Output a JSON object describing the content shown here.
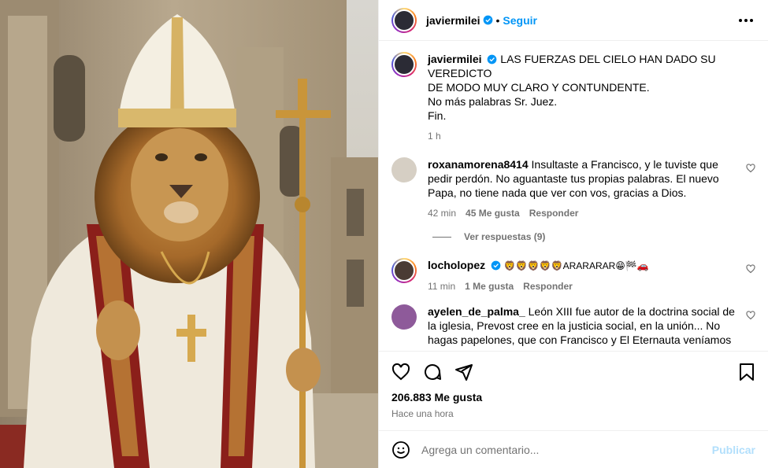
{
  "header": {
    "username": "javiermilei",
    "dot": "•",
    "follow_label": "Seguir"
  },
  "caption": {
    "username": "javiermilei",
    "lines": [
      "LAS FUERZAS DEL CIELO HAN DADO SU VEREDICTO",
      "DE MODO MUY CLARO Y CONTUNDENTE.",
      "No más palabras Sr. Juez.",
      "Fin."
    ],
    "time": "1 h"
  },
  "comments": [
    {
      "username": "roxanamorena8414",
      "text": "Insultaste a Francisco, y le tuviste que pedir perdón. No aguantaste tus propias palabras. El nuevo Papa, no tiene nada que ver con vos, gracias a Dios.",
      "time": "42 min",
      "likes": "45 Me gusta",
      "reply": "Responder",
      "view_replies": "Ver respuestas (9)"
    },
    {
      "username": "locholopez",
      "text": "🦁🦁🦁🦁🦁ARARARAR😁🏁🚗",
      "time": "11 min",
      "likes": "1 Me gusta",
      "reply": "Responder"
    },
    {
      "username": "ayelen_de_palma_",
      "text": "León XIII fue autor de la doctrina social de la iglesia, Prevost cree en la justicia social, en la unión... No hagas papelones, que con Francisco y El Eternauta veníamos"
    }
  ],
  "footer": {
    "likes": "206.883 Me gusta",
    "time_ago": "Hace una hora",
    "comment_placeholder": "Agrega un comentario...",
    "publish_label": "Publicar"
  },
  "colors": {
    "accent": "#0095f6",
    "muted": "#737373",
    "publish_disabled": "#b2dffc"
  },
  "icons": [
    "more-icon",
    "verified-icon",
    "heart-icon",
    "comment-icon",
    "share-icon",
    "save-icon",
    "emoji-icon"
  ]
}
